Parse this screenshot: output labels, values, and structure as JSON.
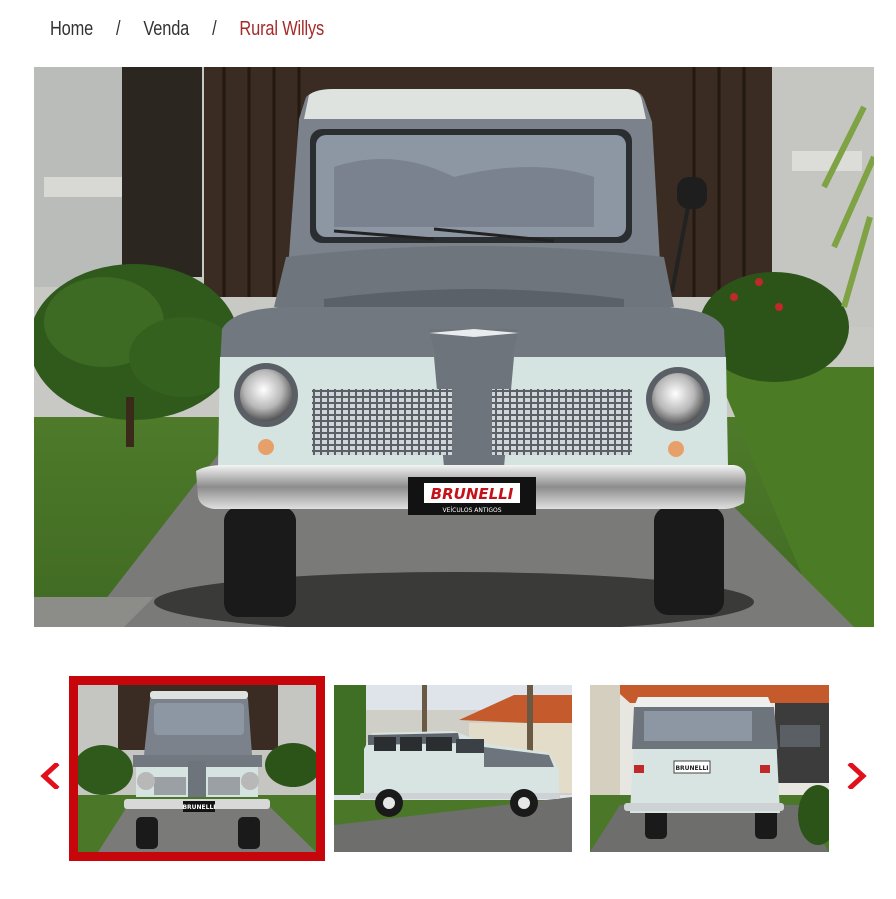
{
  "breadcrumb": {
    "items": [
      "Home",
      "Venda"
    ],
    "separator": "/",
    "current": "Rural Willys"
  },
  "hero": {
    "plate_brand": "BRUNELLI",
    "plate_sub": "VEÍCULOS ANTIGOS"
  },
  "gallery": {
    "prev_icon": "‹",
    "next_icon": "›",
    "selected_index": 0,
    "thumb_plate": "BRUNELLI",
    "thumb_rear_plate": "BRUNELLI"
  },
  "colors": {
    "accent": "#c7060b",
    "arrow": "#e1101a",
    "breadcrumb_current": "#a52a2a",
    "body_light": "#d7e6e2",
    "body_grey": "#6e747c"
  }
}
